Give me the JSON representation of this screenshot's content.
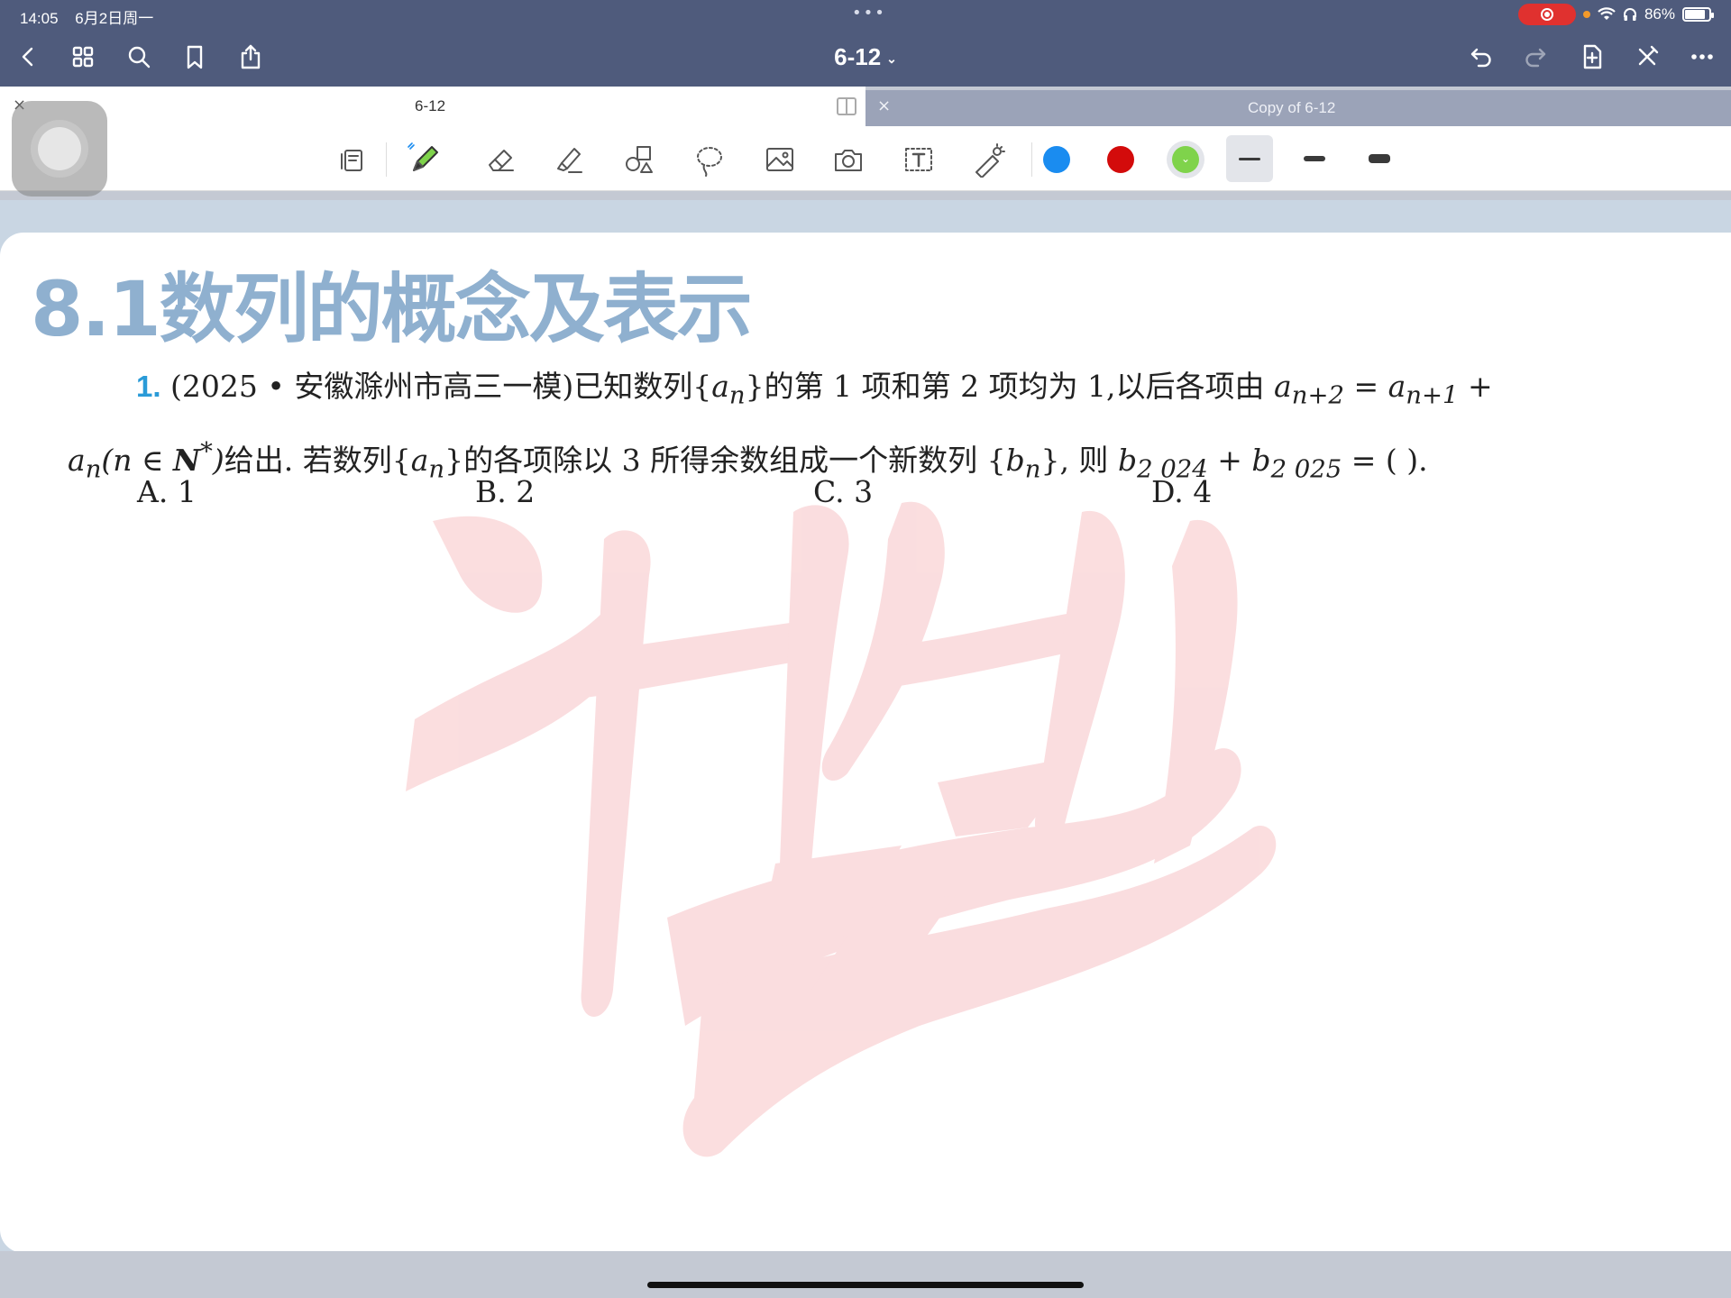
{
  "status": {
    "time": "14:05",
    "date": "6月2日周一",
    "battery": "86%",
    "battery_level": 0.86
  },
  "nav": {
    "title": "6-12"
  },
  "tabs": [
    {
      "label": "6-12",
      "active": true
    },
    {
      "label": "Copy of 6-12",
      "active": false
    }
  ],
  "toolbar": {
    "colors": [
      "#1a8cf0",
      "#d30b0b",
      "#7fd34b"
    ],
    "selected_color": 2,
    "selected_stroke": 0
  },
  "document": {
    "section_title": "8.1数列的概念及表示",
    "question": {
      "number": "1.",
      "source": "(2025 • 安徽滁州市高三一模)",
      "text_part1": "已知数列{",
      "text_part2": "}的第 1 项和第 2 项均为 1,以后各项由",
      "text_part3": "给出. 若数列{",
      "text_part4": "}的各项除以 3 所得余数组成一个新数列 {",
      "text_part5": "}, 则",
      "blank": "= (        )."
    },
    "options": [
      {
        "label": "A.",
        "value": "1"
      },
      {
        "label": "B.",
        "value": "2"
      },
      {
        "label": "C.",
        "value": "3"
      },
      {
        "label": "D.",
        "value": "4"
      }
    ]
  }
}
